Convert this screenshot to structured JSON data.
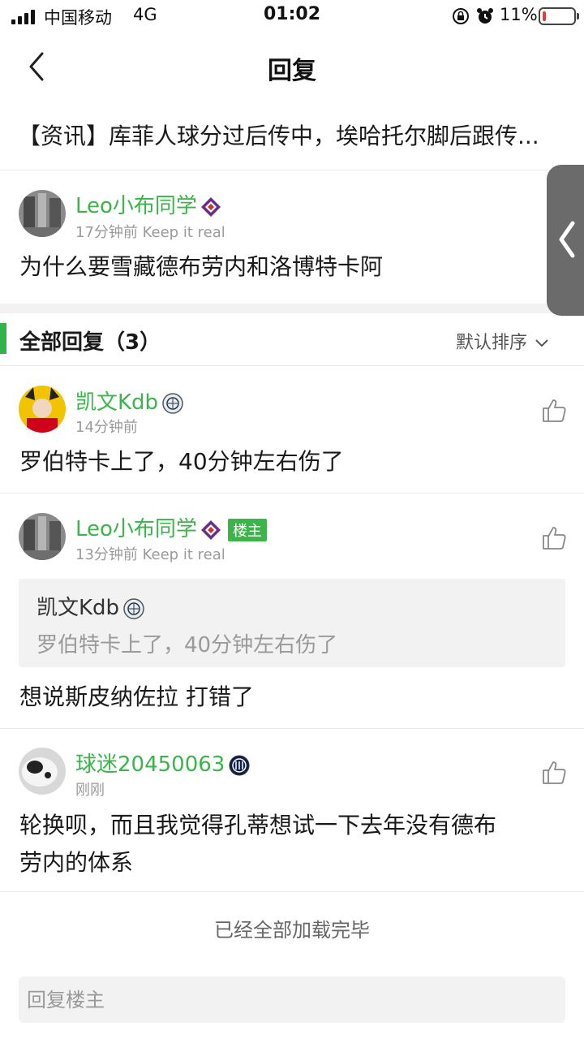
{
  "status_bar": {
    "carrier": "中国移动",
    "network": "4G",
    "time": "01:02",
    "battery_text": "11%",
    "battery_level": 0.11,
    "battery_color": "#e53935"
  },
  "nav": {
    "title": "回复",
    "back_icon": "chevron-left-icon"
  },
  "article": {
    "title": "【资讯】库菲人球分过后传中，埃哈托尔脚后跟传..."
  },
  "original_post": {
    "username": "Leo小布同学",
    "meta": "17分钟前 Keep it real",
    "content": "为什么要雪藏德布劳内和洛博特卡阿"
  },
  "replies_section": {
    "title": "全部回复（3）",
    "sort_label": "默认排序",
    "accent_color": "#2fb44a"
  },
  "replies": [
    {
      "username": "凯文Kdb",
      "meta": "14分钟前",
      "content": "罗伯特卡上了，40分钟左右伤了"
    },
    {
      "username": "Leo小布同学",
      "owner_tag": "楼主",
      "meta": "13分钟前 Keep it real",
      "quote": {
        "username": "凯文Kdb",
        "content": "罗伯特卡上了，40分钟左右伤了"
      },
      "content": "想说斯皮纳佐拉 打错了"
    },
    {
      "username": "球迷20450063",
      "meta": "刚刚",
      "content_line1": "轮换呗，而且我觉得孔蒂想试一下去年没有德布",
      "content_line2": "劳内的体系"
    }
  ],
  "footer": {
    "loaded_text": "已经全部加载完毕",
    "reply_placeholder": "回复楼主"
  },
  "colors": {
    "username_green": "#3bb54a",
    "meta_gray": "#9a9a9a"
  }
}
